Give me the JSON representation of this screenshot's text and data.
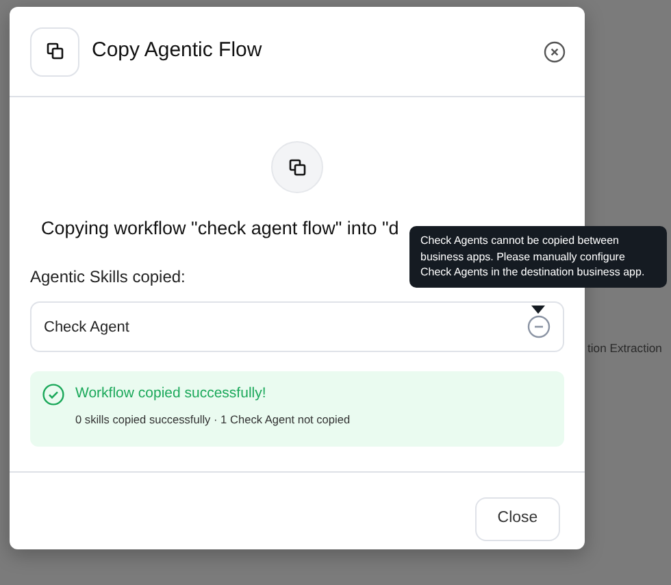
{
  "background": {
    "fragment": "tion Extraction"
  },
  "dialog": {
    "title": "Copy Agentic Flow",
    "heading": "Copying workflow \"check agent flow\" into \"d",
    "skills_label": "Agentic Skills copied:",
    "skills": [
      {
        "name": "Check Agent",
        "copied": false
      }
    ],
    "tooltip": "Check Agents cannot be copied between business apps. Please manually configure Check Agents in the destination business app.",
    "result": {
      "kind": "success",
      "message": "Workflow copied successfully!",
      "detail": "0 skills copied successfully · 1 Check Agent not copied"
    },
    "buttons": [
      "Close"
    ]
  }
}
